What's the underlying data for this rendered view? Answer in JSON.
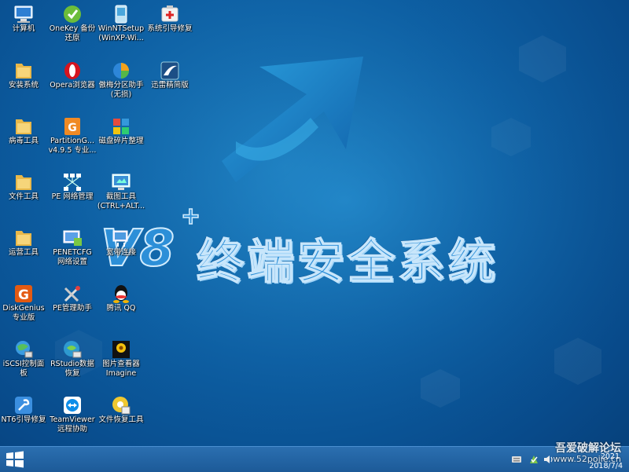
{
  "wallpaper": {
    "brand_logo": "V8",
    "brand_plus": "+",
    "brand_text": "终端安全系统",
    "colors": {
      "bg": "#0d5fa3",
      "accent": "#2c8fd8"
    }
  },
  "desktop_icons": [
    {
      "label": "计算机",
      "icon": "computer-icon"
    },
    {
      "label": "OneKey 备份\n还原",
      "icon": "onekey-icon"
    },
    {
      "label": "WinNTSetup\n(WinXP-Wi...",
      "icon": "winntsetup-icon"
    },
    {
      "label": "系统引导修复",
      "icon": "boot-repair-icon"
    },
    {
      "label": "安装系统",
      "icon": "folder-icon"
    },
    {
      "label": "Opera浏览器",
      "icon": "opera-icon"
    },
    {
      "label": "傲梅分区助手\n(无损)",
      "icon": "partition-assistant-icon"
    },
    {
      "label": "迅雷精简版",
      "icon": "thunder-icon"
    },
    {
      "label": "病毒工具",
      "icon": "folder-icon"
    },
    {
      "label": "PartitionG...\nv4.9.5 专业...",
      "icon": "partitionguru-icon"
    },
    {
      "label": "磁盘碎片整理",
      "icon": "defrag-icon"
    },
    {
      "label": "文件工具",
      "icon": "folder-icon"
    },
    {
      "label": "PE 网络管理",
      "icon": "network-manager-icon"
    },
    {
      "label": "截图工具\n(CTRL+ALT...",
      "icon": "screenshot-icon"
    },
    {
      "label": "运营工具",
      "icon": "folder-icon"
    },
    {
      "label": "PENETCFG\n网络设置",
      "icon": "penetcfg-icon"
    },
    {
      "label": "宽带连接",
      "icon": "broadband-icon"
    },
    {
      "label": "DiskGenius\n专业版",
      "icon": "diskgenius-icon"
    },
    {
      "label": "PE管理助手",
      "icon": "pe-tools-icon"
    },
    {
      "label": "腾讯 QQ",
      "icon": "qq-icon"
    },
    {
      "label": "iSCSI控制面\n板",
      "icon": "iscsi-icon"
    },
    {
      "label": "RStudio数据\n恢复",
      "icon": "rstudio-icon"
    },
    {
      "label": "图片查看器\nImagine",
      "icon": "imagine-icon"
    },
    {
      "label": "NT6引导修复",
      "icon": "nt6-repair-icon"
    },
    {
      "label": "TeamViewer\n远程协助",
      "icon": "teamviewer-icon"
    },
    {
      "label": "文件恢复工具",
      "icon": "file-recovery-icon"
    }
  ],
  "taskbar": {
    "start_icon": "windows-logo-icon",
    "tray_icons": [
      "keyboard-icon",
      "network-icon",
      "volume-icon"
    ],
    "clock_time": "2021",
    "clock_date": "2018/7/4",
    "watermark_line1": "吾爱破解论坛",
    "watermark_line2": "www.52pojie.cn"
  }
}
